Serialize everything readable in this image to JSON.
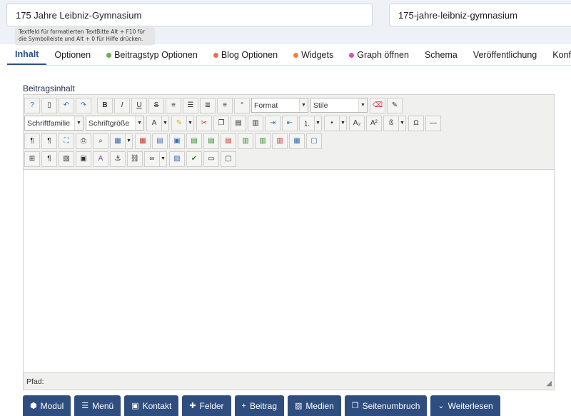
{
  "header": {
    "title_value": "175 Jahre Leibniz-Gymnasium",
    "alias_value": "175-jahre-leibniz-gymnasium",
    "tooltip": "Textfeld für formatierten TextBitte Alt + F10 für die Symbolleiste und Alt + 0 für Hilfe drücken."
  },
  "tabs": [
    {
      "label": "Inhalt",
      "active": true
    },
    {
      "label": "Optionen"
    },
    {
      "label": "Beitragstyp Optionen",
      "dot": "#6ab04c"
    },
    {
      "label": "Blog Optionen",
      "dot": "#e8704a"
    },
    {
      "label": "Widgets",
      "dot": "#f0803c"
    },
    {
      "label": "Graph öffnen",
      "dot": "#d94fc9"
    },
    {
      "label": "Schema"
    },
    {
      "label": "Veröffentlichung"
    },
    {
      "label": "Konfiguri"
    }
  ],
  "editor": {
    "label": "Beitragsinhalt",
    "format_select": "Format",
    "style_select": "Stile",
    "font_family_select": "Schriftfamilie",
    "font_size_select": "Schriftgröße",
    "path_label": "Pfad:"
  },
  "buttons": [
    {
      "label": "Modul",
      "icon": "cube-icon",
      "glyph": "⬢"
    },
    {
      "label": "Menü",
      "icon": "list-icon",
      "glyph": "☰"
    },
    {
      "label": "Kontakt",
      "icon": "contact-card-icon",
      "glyph": "▣"
    },
    {
      "label": "Felder",
      "icon": "puzzle-icon",
      "glyph": "✚"
    },
    {
      "label": "Beitrag",
      "icon": "plus-icon",
      "glyph": "+"
    },
    {
      "label": "Medien",
      "icon": "image-icon",
      "glyph": "▨"
    },
    {
      "label": "Seitenumbruch",
      "icon": "copy-icon",
      "glyph": "❐"
    },
    {
      "label": "Weiterlesen",
      "icon": "chevron-down-icon",
      "glyph": "⌄"
    }
  ],
  "colors": {
    "accent": "#2a4f86",
    "button_bg": "#2f4e7f"
  }
}
